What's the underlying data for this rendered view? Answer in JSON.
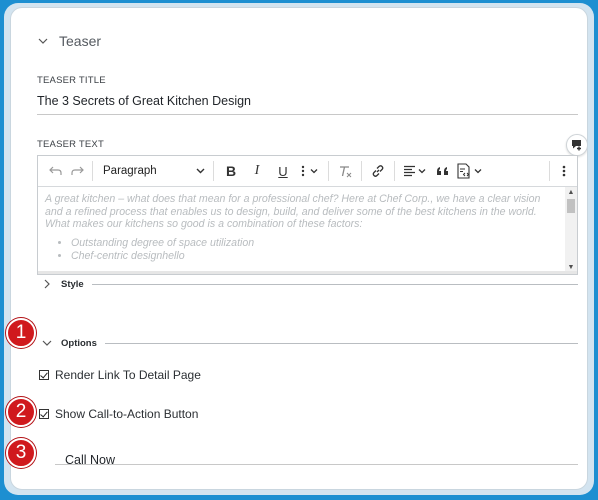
{
  "teaser": {
    "section_title": "Teaser"
  },
  "fields": {
    "title_label": "TEASER TITLE",
    "title_value": "The 3 Secrets of Great Kitchen Design",
    "text_label": "TEASER TEXT"
  },
  "editor": {
    "paragraph_select": "Paragraph",
    "toolbar": {
      "undo_icon": "undo-icon",
      "redo_icon": "redo-icon",
      "bold": "B",
      "italic": "I",
      "underline": "U",
      "quote_icon": "quote-icon"
    },
    "content": {
      "paragraph": "A great kitchen – what does that mean for a professional chef? Here at Chef Corp., we have a clear vision and a refined process that enables us to design, build, and deliver some of the best kitchens in the world. What makes our kitchens so good is a combination of these factors:",
      "bullets": [
        "Outstanding degree of space utilization",
        "Chef-centric designhello"
      ]
    }
  },
  "style_section": {
    "label": "Style"
  },
  "options_section": {
    "label": "Options"
  },
  "checkboxes": {
    "render_link": "Render Link To Detail Page",
    "show_cta": "Show Call-to-Action Button"
  },
  "cta": {
    "value": "Call Now"
  },
  "markers": [
    "1",
    "2",
    "3"
  ],
  "colors": {
    "background": "#1d8fd1",
    "marker": "#d0191d"
  }
}
